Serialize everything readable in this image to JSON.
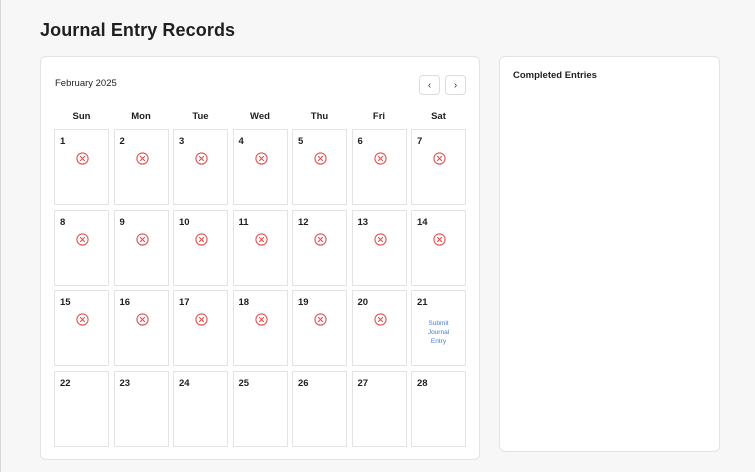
{
  "page": {
    "title": "Journal Entry Records"
  },
  "calendar": {
    "month_label": "February 2025",
    "prev_glyph": "‹",
    "next_glyph": "›",
    "weekdays": [
      "Sun",
      "Mon",
      "Tue",
      "Wed",
      "Thu",
      "Fri",
      "Sat"
    ],
    "days": [
      {
        "day": "1",
        "status": "missed"
      },
      {
        "day": "2",
        "status": "missed"
      },
      {
        "day": "3",
        "status": "missed"
      },
      {
        "day": "4",
        "status": "missed"
      },
      {
        "day": "5",
        "status": "missed"
      },
      {
        "day": "6",
        "status": "missed"
      },
      {
        "day": "7",
        "status": "missed"
      },
      {
        "day": "8",
        "status": "missed"
      },
      {
        "day": "9",
        "status": "missed"
      },
      {
        "day": "10",
        "status": "missed"
      },
      {
        "day": "11",
        "status": "missed"
      },
      {
        "day": "12",
        "status": "missed"
      },
      {
        "day": "13",
        "status": "missed"
      },
      {
        "day": "14",
        "status": "missed"
      },
      {
        "day": "15",
        "status": "missed"
      },
      {
        "day": "16",
        "status": "missed"
      },
      {
        "day": "17",
        "status": "missed"
      },
      {
        "day": "18",
        "status": "missed"
      },
      {
        "day": "19",
        "status": "missed"
      },
      {
        "day": "20",
        "status": "missed"
      },
      {
        "day": "21",
        "status": "today",
        "action_label": "Submit Journal Entry"
      },
      {
        "day": "22",
        "status": "future"
      },
      {
        "day": "23",
        "status": "future"
      },
      {
        "day": "24",
        "status": "future"
      },
      {
        "day": "25",
        "status": "future"
      },
      {
        "day": "26",
        "status": "future"
      },
      {
        "day": "27",
        "status": "future"
      },
      {
        "day": "28",
        "status": "future"
      }
    ],
    "missed_icon": "circle-x-icon",
    "colors": {
      "missed": "#e05252",
      "link": "#4a7bd6"
    }
  },
  "sidebar": {
    "title": "Completed Entries"
  }
}
